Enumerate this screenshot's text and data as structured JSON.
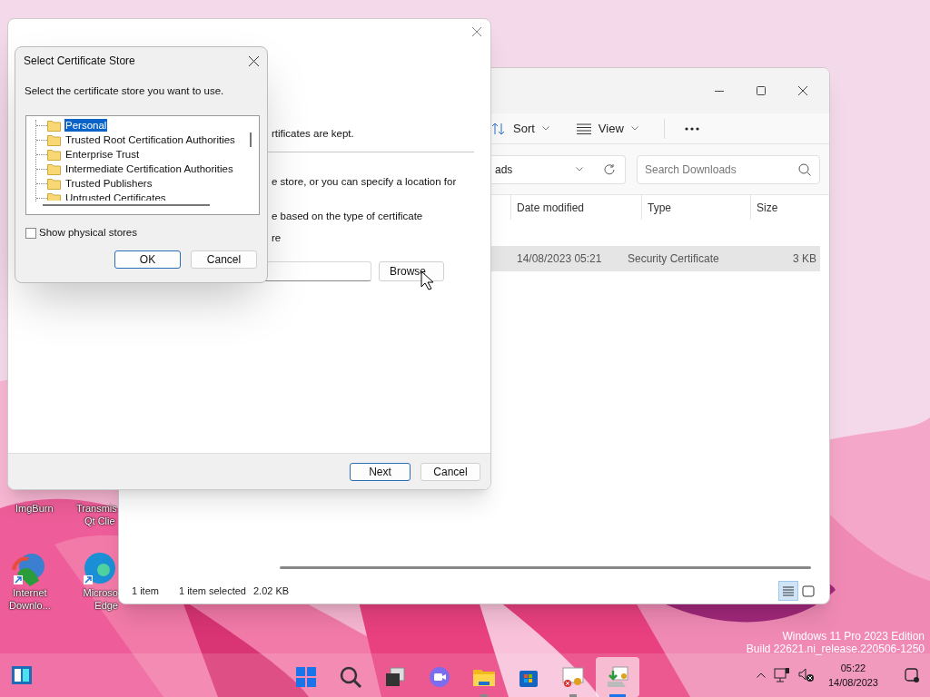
{
  "desktop_icons": [
    {
      "label_lines": [
        "ImgBurn"
      ]
    },
    {
      "label_lines": [
        "Transmis",
        "Qt Clie"
      ]
    },
    {
      "kind": "globe",
      "label_lines": [
        "Internet",
        "Downlo..."
      ]
    },
    {
      "kind": "browser",
      "label_lines": [
        "Microso",
        "Edge"
      ]
    }
  ],
  "explorer": {
    "toolbar": [
      {
        "kind": "sort",
        "label": "Sort"
      },
      {
        "kind": "view",
        "label": "View"
      }
    ],
    "address": "ads",
    "search": {
      "placeholder": "Search Downloads"
    },
    "columns": [
      "Date modified",
      "Type",
      "Size"
    ],
    "rows": [
      {
        "cells": [
          "14/08/2023 05:21",
          "Security Certificate",
          "3 KB"
        ],
        "selected": true
      }
    ],
    "status": [
      "1 item",
      "1 item selected",
      "2.02 KB"
    ],
    "view_modes": [
      {
        "kind": "details",
        "selected": true
      },
      {
        "kind": "tiles",
        "selected": false
      }
    ]
  },
  "wizard": {
    "text_lines": [
      "rtificates are kept.",
      "e store, or you can specify a location for",
      "e based on the type of certificate",
      "re"
    ],
    "browse_button": "Browse",
    "buttons": [
      "Next",
      "Cancel"
    ]
  },
  "store_dialog": {
    "title": "Select Certificate Store",
    "prompt": "Select the certificate store you want to use.",
    "stores": [
      {
        "label": "Personal",
        "selected": true
      },
      {
        "label": "Trusted Root Certification Authorities",
        "selected": false
      },
      {
        "label": "Enterprise Trust",
        "selected": false
      },
      {
        "label": "Intermediate Certification Authorities",
        "selected": false
      },
      {
        "label": "Trusted Publishers",
        "selected": false
      },
      {
        "label": "Untrusted Certificates",
        "selected": false
      }
    ],
    "show_physical_stores": {
      "label": "Show physical stores",
      "checked": false
    },
    "buttons": [
      "OK",
      "Cancel"
    ]
  },
  "edition_notice": [
    "Windows 11 Pro 2023 Edition",
    "Build 22621.ni_release.220506-1250"
  ],
  "taskbar": {
    "apps": [
      {
        "kind": "start",
        "running": false,
        "selected": false
      },
      {
        "kind": "search",
        "running": false,
        "selected": false
      },
      {
        "kind": "task-view",
        "running": false,
        "selected": false
      },
      {
        "kind": "chat",
        "running": false,
        "selected": false
      },
      {
        "kind": "file-explorer",
        "running": true,
        "selected": false
      },
      {
        "kind": "store",
        "running": false,
        "selected": false
      },
      {
        "kind": "certificate",
        "running": true,
        "selected": false
      },
      {
        "kind": "import-wizard",
        "running": true,
        "selected": true
      }
    ],
    "clock": {
      "time": "05:22",
      "date": "14/08/2023"
    }
  }
}
